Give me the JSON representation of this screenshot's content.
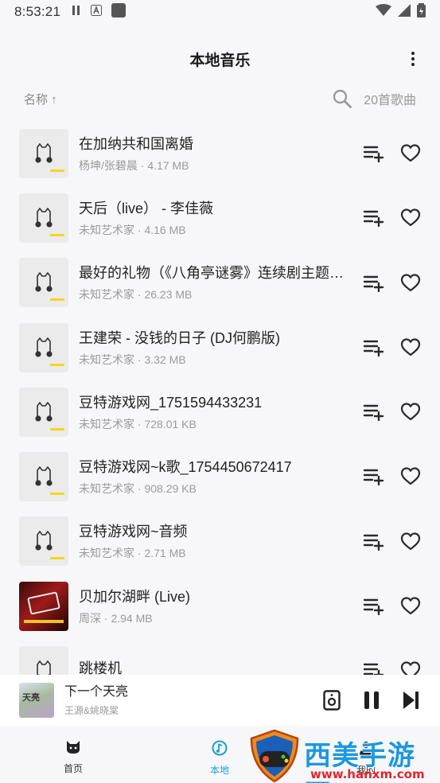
{
  "status_bar": {
    "time": "8:53:21"
  },
  "app_bar": {
    "title": "本地音乐"
  },
  "sort_bar": {
    "sort_label": "名称 ↑",
    "count": "20首歌曲"
  },
  "songs": [
    {
      "title": "在加纳共和国离婚",
      "meta": "杨坤/张碧晨 · 4.17 MB",
      "cover": "default"
    },
    {
      "title": "天后（live） - 李佳薇",
      "meta": "未知艺术家 · 4.16 MB",
      "cover": "default"
    },
    {
      "title": "最好的礼物（《八角亭谜雾》连续剧主题…",
      "meta": "未知艺术家 · 26.23 MB",
      "cover": "default"
    },
    {
      "title": "王建荣 - 没钱的日子 (DJ何鹏版)",
      "meta": "未知艺术家 · 3.32 MB",
      "cover": "default"
    },
    {
      "title": "豆特游戏网_1751594433231",
      "meta": "未知艺术家 · 728.01 KB",
      "cover": "default"
    },
    {
      "title": "豆特游戏网~k歌_1754450672417",
      "meta": "未知艺术家 · 908.29 KB",
      "cover": "default"
    },
    {
      "title": "豆特游戏网~音频",
      "meta": "未知艺术家 · 2.71 MB",
      "cover": "default"
    },
    {
      "title": "贝加尔湖畔 (Live)",
      "meta": "周深 · 2.94 MB",
      "cover": "album"
    },
    {
      "title": "跳楼机",
      "meta": "",
      "cover": "default"
    }
  ],
  "mini_player": {
    "title": "下一个天亮",
    "artist": "王源&姚晓棠",
    "art_text": "天亮"
  },
  "bottom_nav": [
    {
      "label": "首页",
      "icon": "cat-icon",
      "active": false
    },
    {
      "label": "本地",
      "icon": "music-note-icon",
      "active": true
    },
    {
      "label": "我的",
      "icon": "person-icon",
      "active": false
    }
  ],
  "watermark": {
    "text": "西美手游网",
    "url": "www.hanxm.com"
  },
  "colors": {
    "accent": "#1a9fd6",
    "cover_bg": "#ebebeb",
    "cover_bar": "#f2d71c",
    "background": "#f7f7f9"
  }
}
